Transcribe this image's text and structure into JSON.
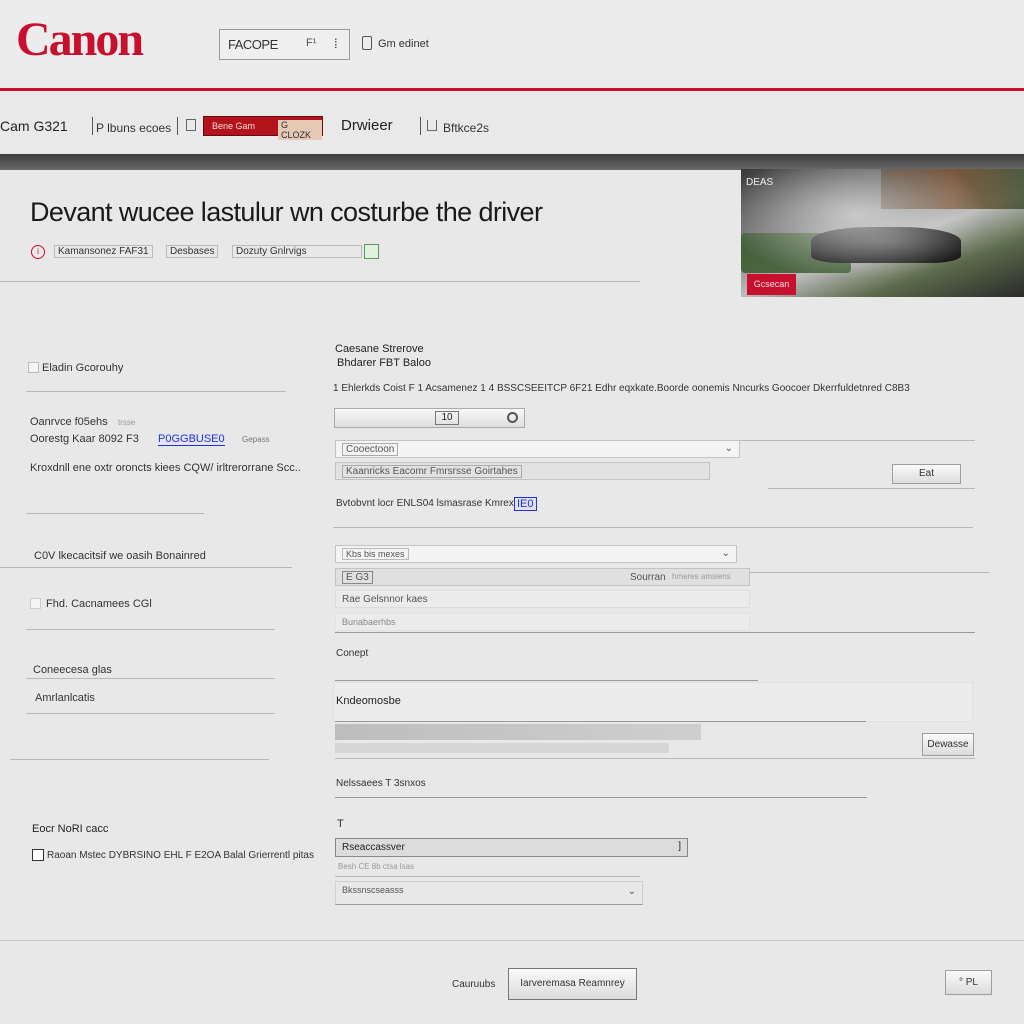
{
  "header": {
    "logo": "Canon",
    "search_value": "FACOPE",
    "search_suffix": "F¹",
    "account_label": "Gm edinet"
  },
  "nav": {
    "model": "Cam G321",
    "item1": "P lbuns ecoes",
    "item2": "Bene Gam",
    "item3": "G CLOZK",
    "item4": "Drwieer",
    "item5": "Bftkce2s"
  },
  "hero": {
    "title": "Devant wucee lastulur wn costurbe the driver",
    "subline1": "Kamansonez FAF31",
    "subline2": "Desbases",
    "subline3": "Dozuty Gnlrvigs",
    "image_caption": "DEAS",
    "image_button": "Gcsecan"
  },
  "sidebar": {
    "item1": "Eladin Gcorouhy",
    "item2a": "Oanrvce f05ehs",
    "item2a_tag": "trsse",
    "item2b": "Oorestg Kaar 8092 F3",
    "item2b_link": "P0GGBUSE0",
    "item2b_tag": "Gepass",
    "item3": "Kroxdnll ene oxtr oroncts kiees CQW/ irltrerorrane Scc..",
    "item4": "C0V lkecacitsif we oasih Bonainred",
    "item5": "Fhd. Cacnamees CGl",
    "item6": "Coneecesa glas",
    "item7": "Amrlanlcatis",
    "item8_heading": "Eocr NoRI cacc",
    "item8": "Raoan Mstec DYBRSINO EHL F E2OA Balal Grierrentl pitas"
  },
  "main": {
    "section_title": "Caesane Strerove",
    "section_subtitle": "Bhdarer FBT Baloo",
    "desc": "1 Ehlerkds Coist F 1 Acsamenez 1 4 BSSCSEEITCP 6F21 Edhr eqxkate.Boorde oonemis Nncurks Goocoer Dkerrfuldetnred C8B3",
    "search_left": "",
    "search_mid": "10",
    "field1_value": "Cooectoon",
    "field2_value": "Kaanricks Eacomr Fmrsrsse Goirtahes",
    "side_btn": "Eat",
    "info_line": "Bvtobvnt locr ENLS04 lsmasrase Kmrex/",
    "info_link": "IE0",
    "select1_value": "Kbs bis mexes",
    "row2_left": "E G3",
    "row2_right": "Sourran",
    "row2_right_extra": "hmeres amsiens",
    "row3_value": "Rae Gelsnnor kaes",
    "row4_value": "Bunabaerhbs",
    "label_compt": "Conept",
    "label_download": "Kndeomosbe",
    "download_btn": "Dewasse",
    "label_release": "Nelssaees T 3snxos",
    "label_t": "T",
    "select2_value": "Rseaccassver",
    "select2_hint": "Besh CE 8b ctsa lsas",
    "select3_value": "Bkssnscseasss"
  },
  "footer": {
    "label": "Cauruubs",
    "primary_btn": "Iarveremasa Reamnrey",
    "secondary_btn": "° PL"
  },
  "colors": {
    "brand_red": "#c8102e",
    "nav_badge_red": "#b3131c",
    "link_blue": "#2233cc"
  }
}
